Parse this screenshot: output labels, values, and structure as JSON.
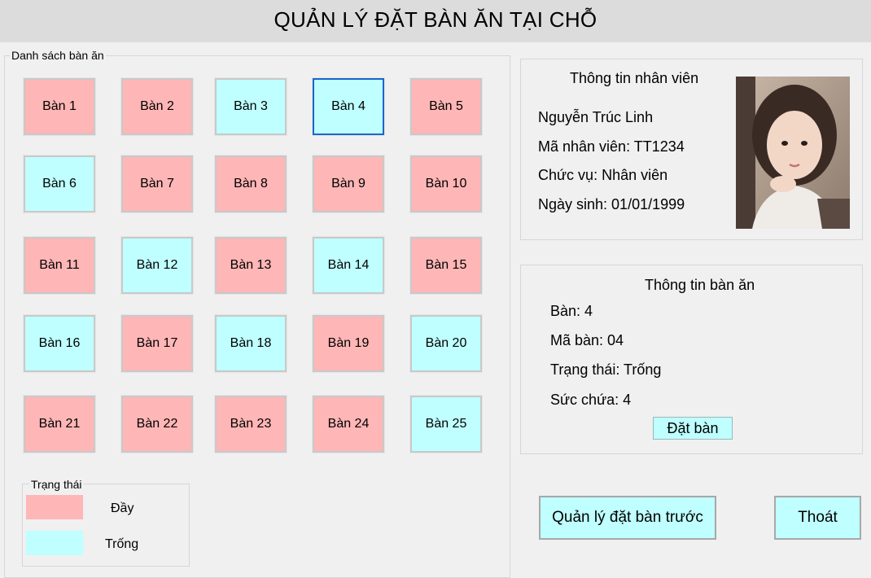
{
  "window": {
    "title": "QUẢN LÝ ĐẶT BÀN ĂN TẠI CHỖ"
  },
  "tables_panel": {
    "legend": "Danh sách bàn ăn",
    "tables": [
      {
        "label": "Bàn 1",
        "status": "full"
      },
      {
        "label": "Bàn 2",
        "status": "full"
      },
      {
        "label": "Bàn 3",
        "status": "empty"
      },
      {
        "label": "Bàn 4",
        "status": "empty",
        "selected": true
      },
      {
        "label": "Bàn 5",
        "status": "full"
      },
      {
        "label": "Bàn 6",
        "status": "empty"
      },
      {
        "label": "Bàn 7",
        "status": "full"
      },
      {
        "label": "Bàn 8",
        "status": "full"
      },
      {
        "label": "Bàn 9",
        "status": "full"
      },
      {
        "label": "Bàn 10",
        "status": "full"
      },
      {
        "label": "Bàn 11",
        "status": "full"
      },
      {
        "label": "Bàn 12",
        "status": "empty"
      },
      {
        "label": "Bàn 13",
        "status": "full"
      },
      {
        "label": "Bàn 14",
        "status": "empty"
      },
      {
        "label": "Bàn 15",
        "status": "full"
      },
      {
        "label": "Bàn 16",
        "status": "empty"
      },
      {
        "label": "Bàn 17",
        "status": "full"
      },
      {
        "label": "Bàn 18",
        "status": "empty"
      },
      {
        "label": "Bàn 19",
        "status": "full"
      },
      {
        "label": "Bàn 20",
        "status": "empty"
      },
      {
        "label": "Bàn 21",
        "status": "full"
      },
      {
        "label": "Bàn 22",
        "status": "full"
      },
      {
        "label": "Bàn 23",
        "status": "full"
      },
      {
        "label": "Bàn 24",
        "status": "full"
      },
      {
        "label": "Bàn 25",
        "status": "empty"
      }
    ]
  },
  "status_legend": {
    "title": "Trạng thái",
    "full_label": "Đầy",
    "empty_label": "Trống",
    "full_color": "#ffb6b6",
    "empty_color": "#bfffff"
  },
  "staff": {
    "title": "Thông tin nhân viên",
    "name": "Nguyễn Trúc Linh",
    "id_line": "Mã nhân viên: TT1234",
    "role_line": "Chức vụ: Nhân viên",
    "dob_line": "Ngày sinh: 01/01/1999",
    "photo_icon": "employee-photo"
  },
  "table_info": {
    "title": "Thông tin bàn ăn",
    "table_line": "Bàn: 4",
    "code_line": "Mã bàn: 04",
    "status_line": "Trạng thái: Trống",
    "capacity_line": "Sức chứa: 4",
    "book_button": "Đặt bàn"
  },
  "actions": {
    "manage_label": "Quản lý đặt bàn trước",
    "exit_label": "Thoát"
  }
}
